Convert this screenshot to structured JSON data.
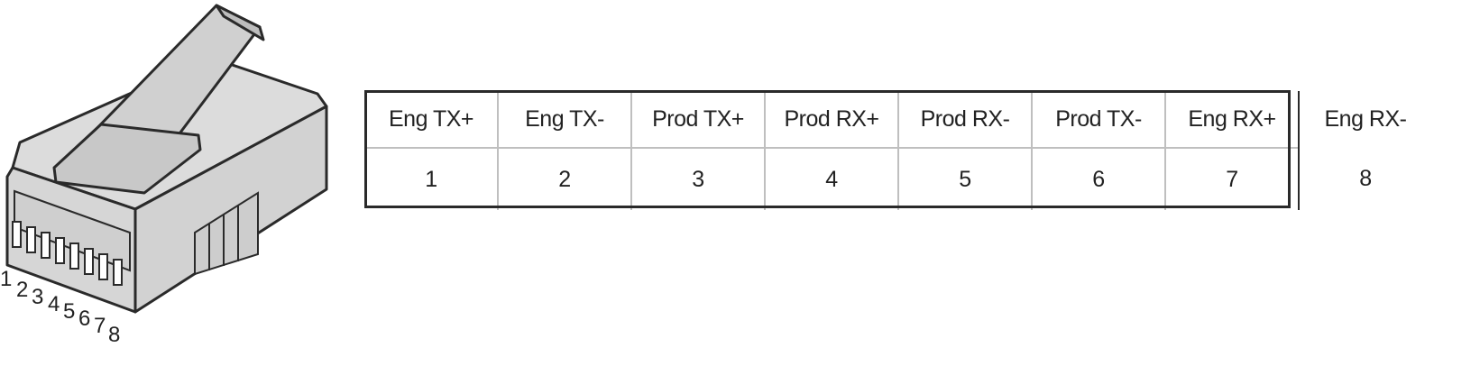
{
  "pin_labels": [
    "1",
    "2",
    "3",
    "4",
    "5",
    "6",
    "7",
    "8"
  ],
  "pinout": {
    "signals": [
      "Eng TX+",
      "Eng TX-",
      "Prod TX+",
      "Prod RX+",
      "Prod RX-",
      "Prod TX-",
      "Eng RX+",
      "Eng RX-"
    ],
    "pins": [
      "1",
      "2",
      "3",
      "4",
      "5",
      "6",
      "7",
      "8"
    ]
  },
  "colors": {
    "connector_fill": "#dcdcdc",
    "connector_shade": "#c8c8c8",
    "connector_outline": "#2a2a2a",
    "grid_lines": "#bfbfbf",
    "table_border": "#2a2a2a"
  }
}
